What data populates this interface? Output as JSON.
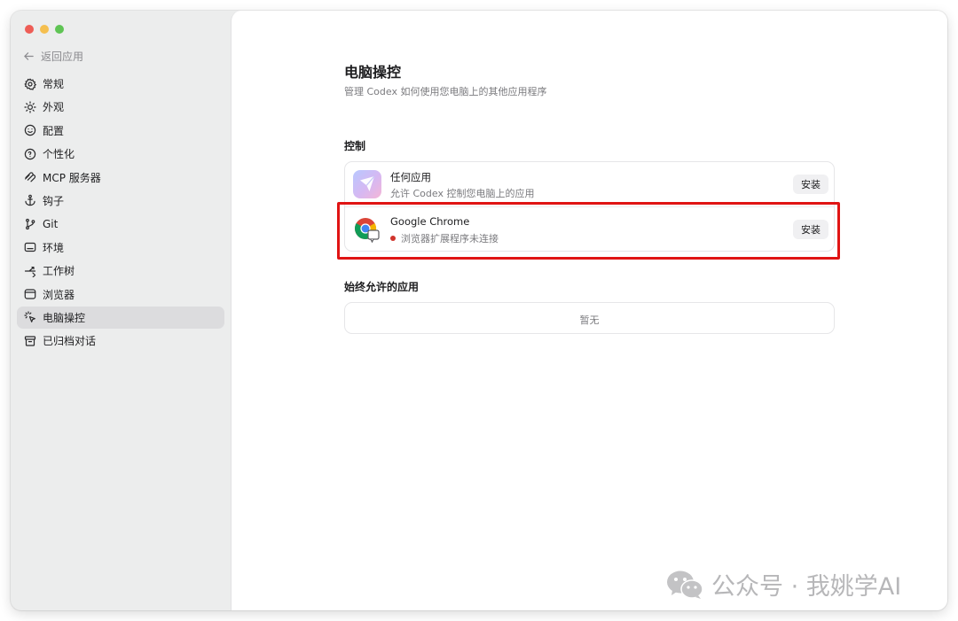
{
  "window": {
    "traffic_colors": [
      "#ee5d56",
      "#f5bf4f",
      "#5fc454"
    ]
  },
  "sidebar": {
    "back_label": "返回应用",
    "items": [
      {
        "label": "常规",
        "icon": "gear-icon"
      },
      {
        "label": "外观",
        "icon": "sun-icon"
      },
      {
        "label": "配置",
        "icon": "config-icon"
      },
      {
        "label": "个性化",
        "icon": "personalize-icon"
      },
      {
        "label": "MCP 服务器",
        "icon": "mcp-icon"
      },
      {
        "label": "钩子",
        "icon": "anchor-icon"
      },
      {
        "label": "Git",
        "icon": "git-branch-icon"
      },
      {
        "label": "环境",
        "icon": "terminal-icon"
      },
      {
        "label": "工作树",
        "icon": "worktree-icon"
      },
      {
        "label": "浏览器",
        "icon": "browser-icon"
      },
      {
        "label": "电脑操控",
        "icon": "pointer-icon",
        "active": true
      },
      {
        "label": "已归档对话",
        "icon": "archive-icon"
      }
    ]
  },
  "main": {
    "title": "电脑操控",
    "subtitle": "管理 Codex 如何使用您电脑上的其他应用程序",
    "control_section": {
      "label": "控制",
      "rows": [
        {
          "title": "任何应用",
          "subtitle": "允许 Codex 控制您电脑上的应用",
          "button": "安装",
          "icon": "paper-plane-app-icon"
        },
        {
          "title": "Google Chrome",
          "subtitle": "浏览器扩展程序未连接",
          "status_color": "#d0342c",
          "button": "安装",
          "icon": "chrome-icon"
        }
      ]
    },
    "always_section": {
      "label": "始终允许的应用",
      "empty_text": "暂无"
    }
  },
  "annotation": {
    "highlight_color": "#e01414"
  },
  "watermark": {
    "text": "公众号 · 我姚学AI",
    "icon": "wechat-icon"
  }
}
